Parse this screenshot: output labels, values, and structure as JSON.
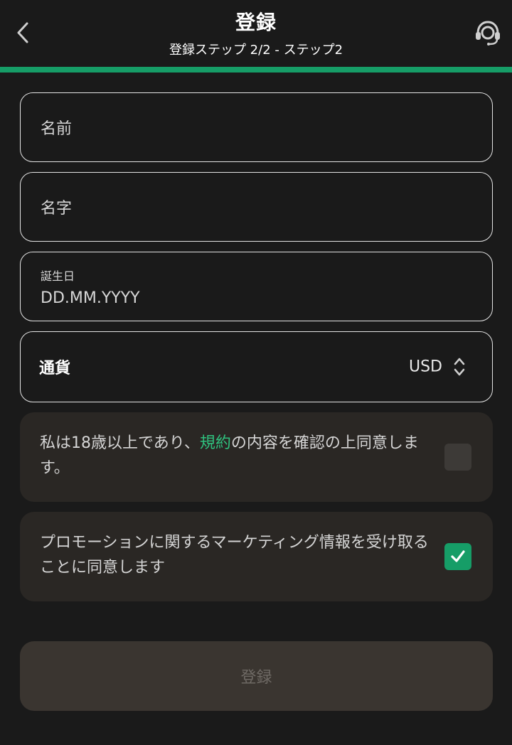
{
  "header": {
    "title": "登録",
    "subtitle": "登録ステップ 2/2 - ステップ2",
    "back_icon": "chevron-left-icon",
    "support_icon": "headset-icon"
  },
  "progress": {
    "fraction": 1.0,
    "color": "#169d67"
  },
  "form": {
    "first_name": {
      "placeholder": "名前"
    },
    "last_name": {
      "placeholder": "名字"
    },
    "birthdate": {
      "label": "誕生日",
      "placeholder": "DD.MM.YYYY"
    },
    "currency": {
      "label": "通貨",
      "value": "USD",
      "icon": "chevron-up-down-icon"
    }
  },
  "consents": {
    "terms": {
      "text_before": "私は18歳以上であり、",
      "link": "規約",
      "text_after": "の内容を確認の上同意します。",
      "checked": false
    },
    "marketing": {
      "text": "プロモーションに関するマーケティング情報を受け取ることに同意します",
      "checked": true
    }
  },
  "submit": {
    "label": "登録",
    "enabled": false
  },
  "colors": {
    "background": "#1a1a1a",
    "accent": "#169d67",
    "link": "#2fc17e",
    "card": "#2a2724"
  }
}
